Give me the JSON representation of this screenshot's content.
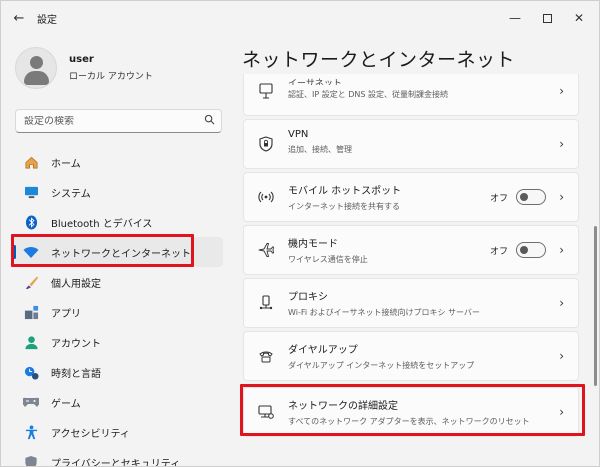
{
  "window": {
    "title": "設定",
    "back_icon": "arrow-left-icon",
    "controls": [
      "minimize-icon",
      "maximize-icon",
      "close-icon"
    ]
  },
  "user": {
    "name": "user",
    "account": "ローカル アカウント"
  },
  "search": {
    "placeholder": "設定の検索"
  },
  "nav": {
    "items": [
      {
        "label": "ホーム",
        "icon": "home-icon"
      },
      {
        "label": "システム",
        "icon": "system-icon"
      },
      {
        "label": "Bluetooth とデバイス",
        "icon": "bluetooth-icon"
      },
      {
        "label": "ネットワークとインターネット",
        "icon": "wifi-icon",
        "active": true
      },
      {
        "label": "個人用設定",
        "icon": "brush-icon"
      },
      {
        "label": "アプリ",
        "icon": "apps-icon"
      },
      {
        "label": "アカウント",
        "icon": "account-icon"
      },
      {
        "label": "時刻と言語",
        "icon": "clock-icon"
      },
      {
        "label": "ゲーム",
        "icon": "gamepad-icon"
      },
      {
        "label": "アクセシビリティ",
        "icon": "accessibility-icon"
      },
      {
        "label": "プライバシーとセキュリティ",
        "icon": "shield-icon"
      }
    ]
  },
  "main": {
    "title": "ネットワークとインターネット",
    "cards": [
      {
        "title": "イーサネット",
        "sub": "認証、IP 設定と DNS 設定、従量制課金接続",
        "icon": "ethernet-icon"
      },
      {
        "title": "VPN",
        "sub": "追加、接続、管理",
        "icon": "vpn-shield-icon"
      },
      {
        "title": "モバイル ホットスポット",
        "sub": "インターネット接続を共有する",
        "icon": "hotspot-icon",
        "toggle": "オフ",
        "toggle_on": false
      },
      {
        "title": "機内モード",
        "sub": "ワイヤレス通信を停止",
        "icon": "airplane-icon",
        "toggle": "オフ",
        "toggle_on": false
      },
      {
        "title": "プロキシ",
        "sub": "Wi-Fi およびイーサネット接続向けプロキシ サーバー",
        "icon": "proxy-icon"
      },
      {
        "title": "ダイヤルアップ",
        "sub": "ダイヤルアップ インターネット接続をセットアップ",
        "icon": "dialup-icon"
      },
      {
        "title": "ネットワークの詳細設定",
        "sub": "すべてのネットワーク アダプターを表示、ネットワークのリセット",
        "icon": "network-adapter-icon"
      }
    ]
  },
  "colors": {
    "accent": "#005fb8",
    "highlight": "#e0141e"
  }
}
